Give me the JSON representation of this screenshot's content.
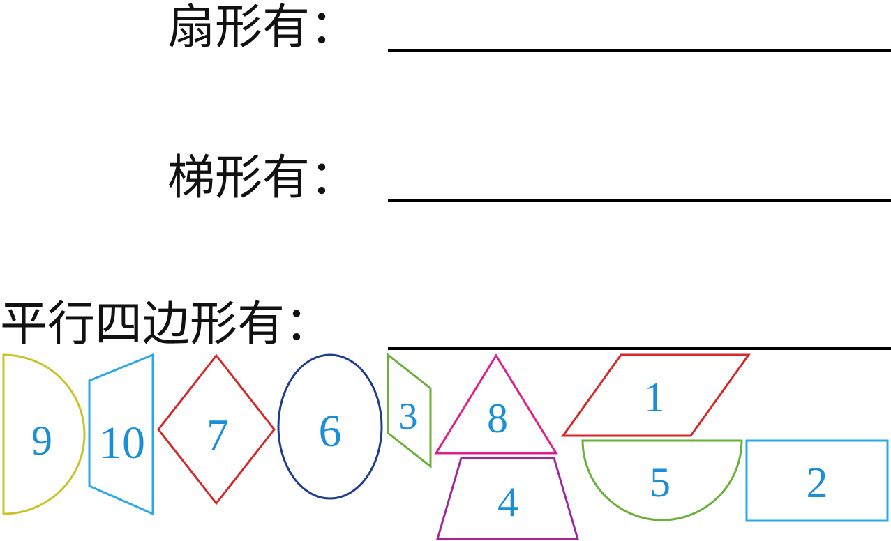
{
  "questions": [
    {
      "label": "扇形有："
    },
    {
      "label": "梯形有："
    },
    {
      "label": "平行四边形有："
    }
  ],
  "colors": {
    "text": "#111111",
    "number": "#1a8fd8",
    "yellow": "#c9c22a",
    "cyan": "#2aa8e8",
    "red": "#d62828",
    "navy": "#1f3d8f",
    "green": "#6ab03a",
    "magenta": "#e0208a",
    "purple": "#a0289a"
  },
  "shapes": [
    {
      "number": "1",
      "kind": "parallelogram",
      "color": "red"
    },
    {
      "number": "2",
      "kind": "rectangle",
      "color": "cyan"
    },
    {
      "number": "3",
      "kind": "parallelogram",
      "color": "green"
    },
    {
      "number": "4",
      "kind": "trapezoid",
      "color": "purple"
    },
    {
      "number": "5",
      "kind": "semicircle",
      "color": "green"
    },
    {
      "number": "6",
      "kind": "ellipse",
      "color": "navy"
    },
    {
      "number": "7",
      "kind": "rhombus",
      "color": "red"
    },
    {
      "number": "8",
      "kind": "triangle",
      "color": "magenta"
    },
    {
      "number": "9",
      "kind": "semicircle",
      "color": "yellow"
    },
    {
      "number": "10",
      "kind": "trapezoid",
      "color": "cyan"
    }
  ]
}
